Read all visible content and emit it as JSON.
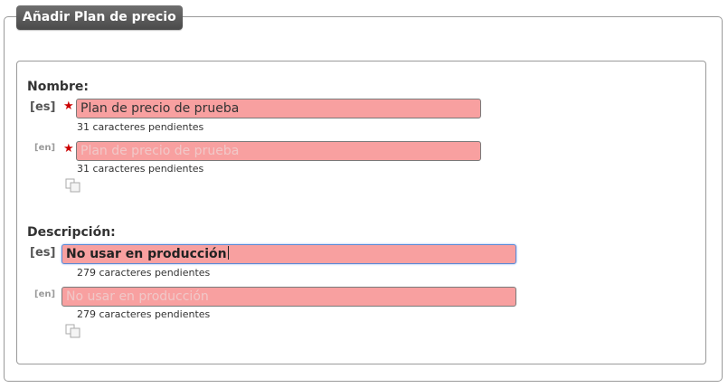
{
  "form": {
    "legend": "Añadir Plan de precio"
  },
  "nombre": {
    "label": "Nombre:",
    "es": {
      "lang": "[es]",
      "value": "Plan de precio de prueba",
      "remaining": "31 caracteres pendientes"
    },
    "en": {
      "lang": "[en]",
      "placeholder": "Plan de precio de prueba",
      "remaining": "31 caracteres pendientes"
    },
    "copy_icon": "copy-icon"
  },
  "descripcion": {
    "label": "Descripción:",
    "es": {
      "lang": "[es]",
      "value": "No usar en producción",
      "remaining": "279 caracteres pendientes"
    },
    "en": {
      "lang": "[en]",
      "placeholder": "No usar en producción",
      "remaining": "279 caracteres pendientes"
    },
    "copy_icon": "copy-icon"
  },
  "colors": {
    "input_error_bg": "#f8a0a0",
    "required_star": "#cc0000",
    "legend_bg": "#555555",
    "focus_border": "#5b8ad6"
  }
}
